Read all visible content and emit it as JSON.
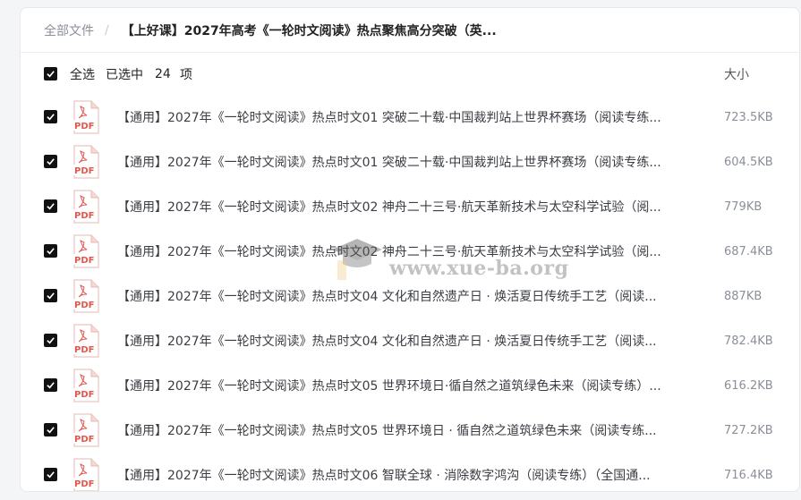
{
  "breadcrumb": {
    "root": "全部文件",
    "separator": "/",
    "current": "【上好课】2027年高考《一轮时文阅读》热点聚焦高分突破（英..."
  },
  "header": {
    "select_all": "全选",
    "selected_prefix": "已选中",
    "selected_count": "24",
    "selected_unit": "项",
    "size_col": "大小"
  },
  "files": [
    {
      "name": "【通用】2027年《一轮时文阅读》热点时文01 突破二十载·中国裁判站上世界杯赛场（阅读专练...",
      "size": "723.5KB"
    },
    {
      "name": "【通用】2027年《一轮时文阅读》热点时文01 突破二十载·中国裁判站上世界杯赛场（阅读专练...",
      "size": "604.5KB"
    },
    {
      "name": "【通用】2027年《一轮时文阅读》热点时文02 神舟二十三号·航天革新技术与太空科学试验（阅...",
      "size": "779KB"
    },
    {
      "name": "【通用】2027年《一轮时文阅读》热点时文02 神舟二十三号·航天革新技术与太空科学试验（阅...",
      "size": "687.4KB"
    },
    {
      "name": "【通用】2027年《一轮时文阅读》热点时文04 文化和自然遗产日 · 焕活夏日传统手工艺（阅读...",
      "size": "887KB"
    },
    {
      "name": "【通用】2027年《一轮时文阅读》热点时文04 文化和自然遗产日 · 焕活夏日传统手工艺（阅读...",
      "size": "782.4KB"
    },
    {
      "name": "【通用】2027年《一轮时文阅读》热点时文05 世界环境日·循自然之道筑绿色未来（阅读专练）...",
      "size": "616.2KB"
    },
    {
      "name": "【通用】2027年《一轮时文阅读》热点时文05 世界环境日 · 循自然之道筑绿色未来（阅读专练...",
      "size": "727.2KB"
    },
    {
      "name": "【通用】2027年《一轮时文阅读》热点时文06 智联全球 · 消除数字鸿沟（阅读专练）（全国通...",
      "size": "716.4KB"
    }
  ],
  "icons": {
    "file": "pdf-icon",
    "checkbox": "checkbox-checked-icon"
  },
  "watermark": "www.xue-ba.org",
  "colors": {
    "pdf_red": "#e2574c",
    "checkbox": "#111111"
  }
}
